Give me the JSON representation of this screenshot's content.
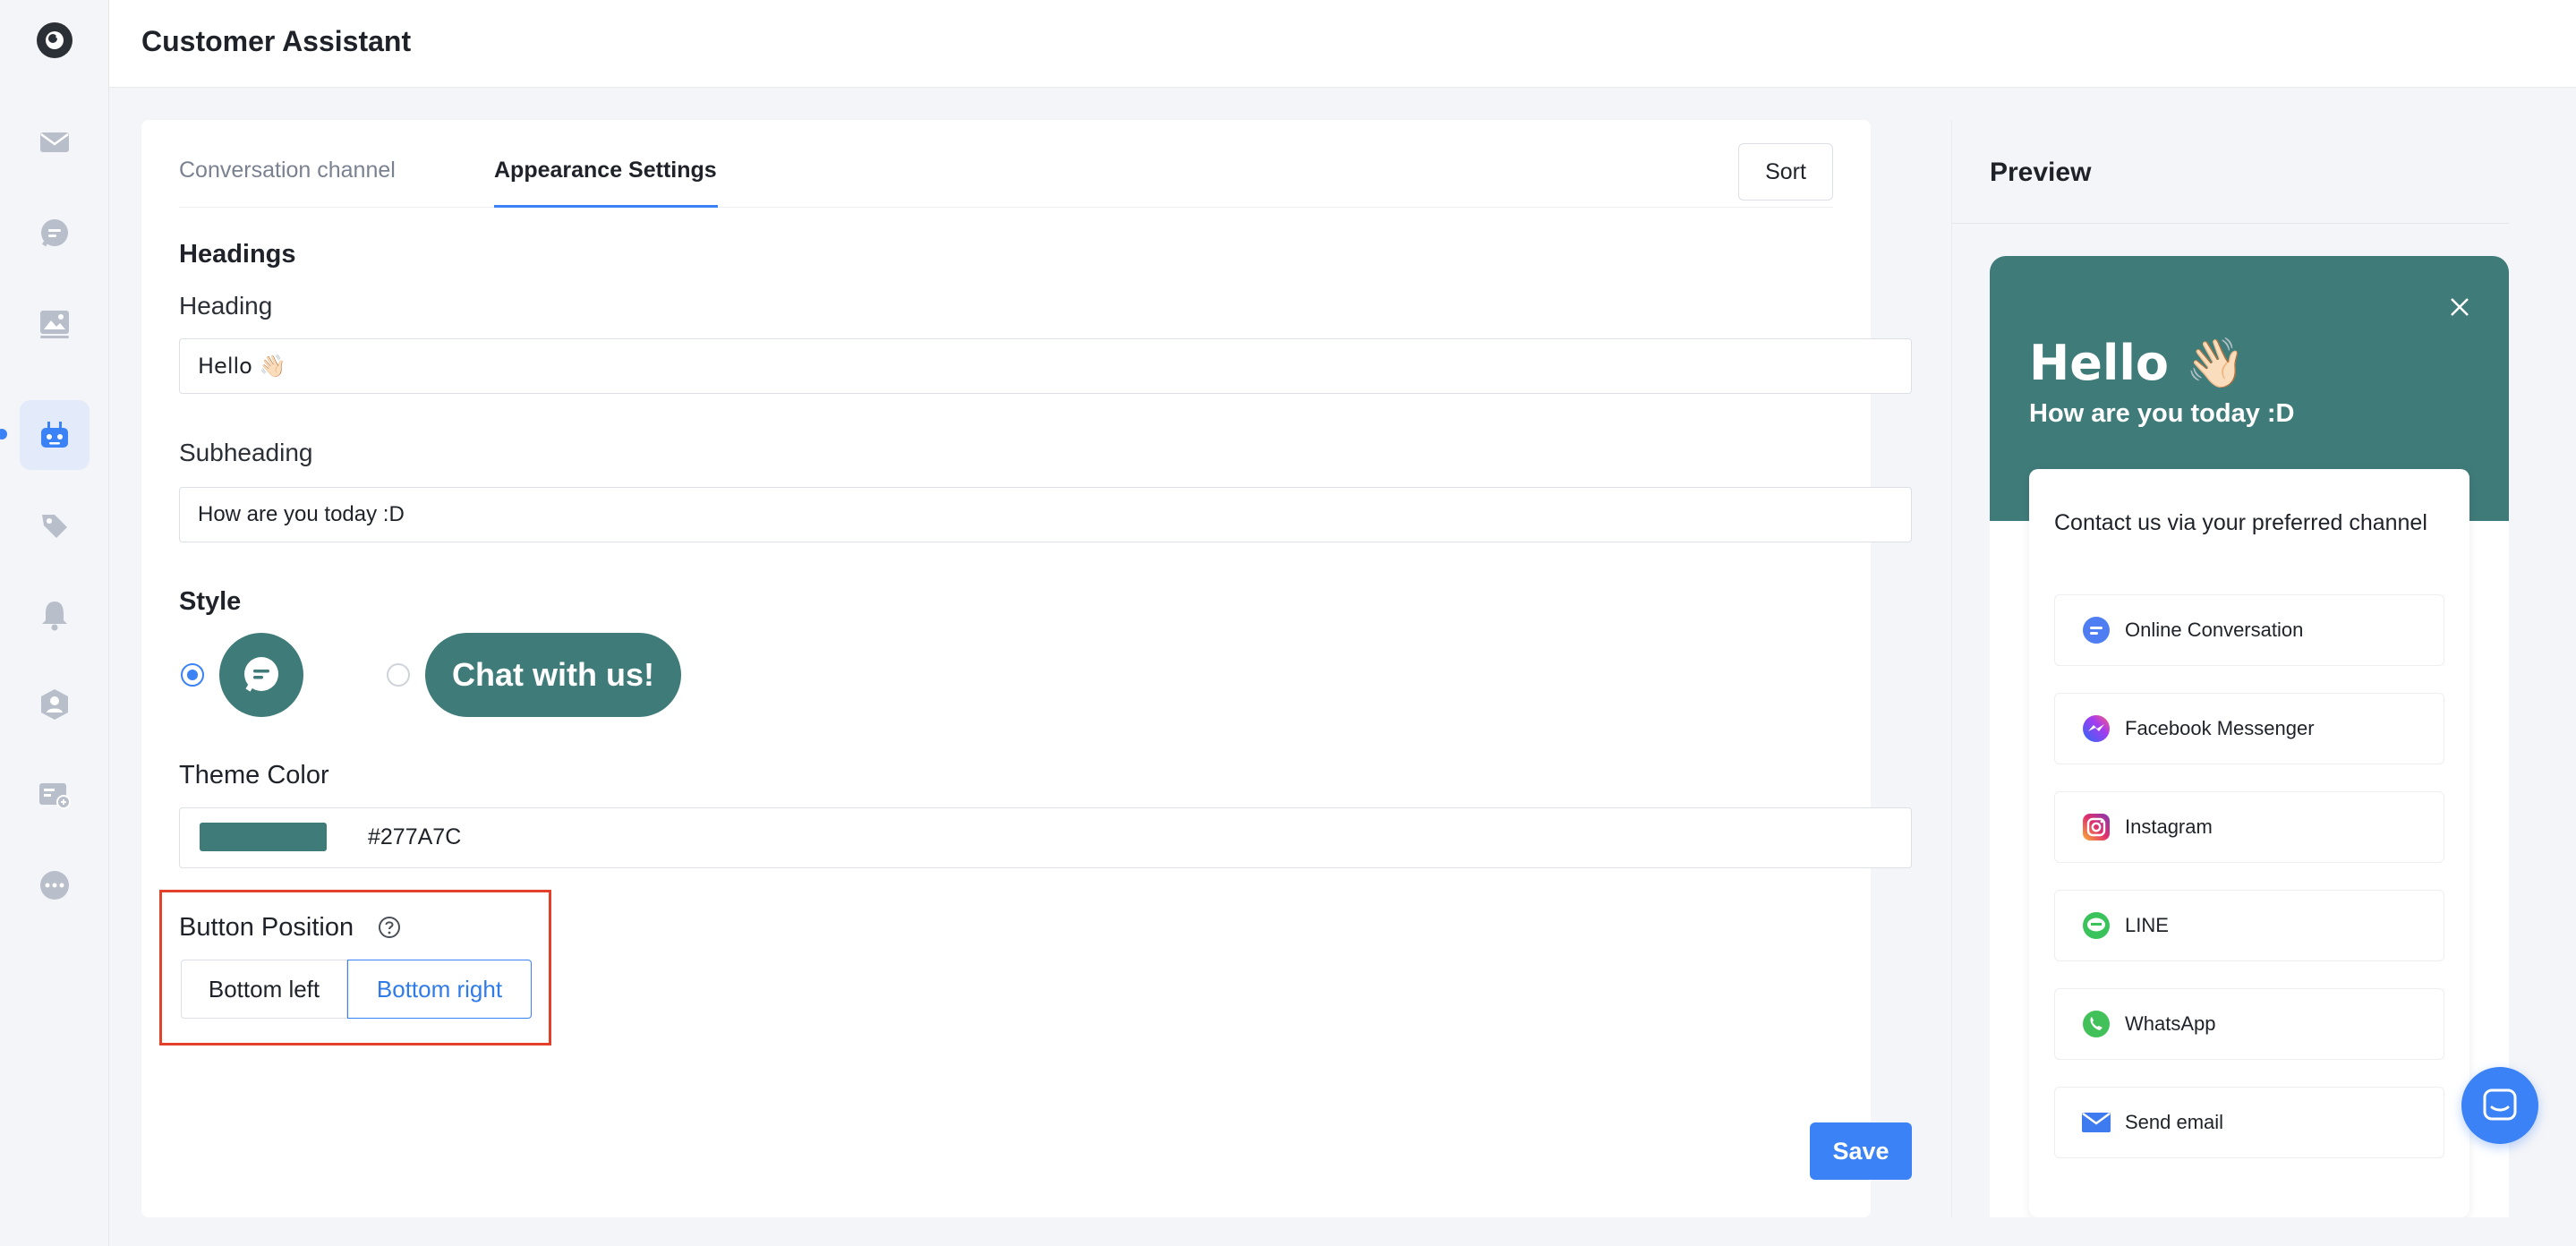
{
  "app": {
    "title": "Customer Assistant"
  },
  "tabs": [
    {
      "label": "Conversation channel"
    },
    {
      "label": "Appearance Settings"
    }
  ],
  "toolbar": {
    "sort_label": "Sort"
  },
  "form": {
    "headings_section": "Headings",
    "heading_label": "Heading",
    "heading_value": "Hello 👋🏻",
    "subheading_label": "Subheading",
    "subheading_value": "How are you today :D",
    "style_section": "Style",
    "style_pill_text": "Chat with us!",
    "theme_color_label": "Theme Color",
    "theme_color_value": "#277A7C",
    "button_position_label": "Button Position",
    "position_left": "Bottom left",
    "position_right": "Bottom right",
    "save_label": "Save"
  },
  "preview": {
    "title": "Preview",
    "heading": "Hello 👋🏻",
    "subheading": "How are you today :D",
    "card_title": "Contact us via your preferred channel",
    "channels": [
      {
        "label": "Online Conversation",
        "icon": "chat-icon"
      },
      {
        "label": "Facebook Messenger",
        "icon": "messenger-icon"
      },
      {
        "label": "Instagram",
        "icon": "instagram-icon"
      },
      {
        "label": "LINE",
        "icon": "line-icon"
      },
      {
        "label": "WhatsApp",
        "icon": "whatsapp-icon"
      },
      {
        "label": "Send email",
        "icon": "email-icon"
      }
    ]
  },
  "colors": {
    "theme": "#3f7b79",
    "accent": "#3b82f6",
    "highlight": "#e2402a"
  }
}
